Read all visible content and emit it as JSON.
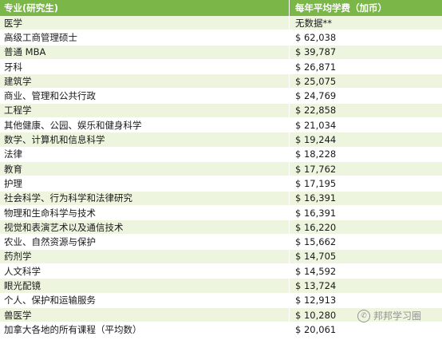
{
  "header": {
    "col1": "专业(研究生)",
    "col2": "每年平均学费（加币）"
  },
  "rows": [
    {
      "name": "医学",
      "fee": "无数据**"
    },
    {
      "name": "高级工商管理硕士",
      "fee": "$ 62,038"
    },
    {
      "name": "普通 MBA",
      "fee": "$ 39,787"
    },
    {
      "name": "牙科",
      "fee": "$ 26,871"
    },
    {
      "name": "建筑学",
      "fee": "$ 25,075"
    },
    {
      "name": "商业、管理和公共行政",
      "fee": "$ 24,769"
    },
    {
      "name": "工程学",
      "fee": "$ 22,858"
    },
    {
      "name": "其他健康、公园、娱乐和健身科学",
      "fee": "$ 21,034"
    },
    {
      "name": "数学、计算机和信息科学",
      "fee": "$ 19,244"
    },
    {
      "name": "法律",
      "fee": "$ 18,228"
    },
    {
      "name": "教育",
      "fee": "$ 17,762"
    },
    {
      "name": "护理",
      "fee": "$ 17,195"
    },
    {
      "name": "社会科学、行为科学和法律研究",
      "fee": "$ 16,391"
    },
    {
      "name": "物理和生命科学与技术",
      "fee": "$ 16,391"
    },
    {
      "name": "视觉和表演艺术以及通信技术",
      "fee": "$ 16,220"
    },
    {
      "name": "农业、自然资源与保护",
      "fee": "$ 15,662"
    },
    {
      "name": "药剂学",
      "fee": "$ 14,705"
    },
    {
      "name": "人文科学",
      "fee": "$ 14,592"
    },
    {
      "name": "眼光配镜",
      "fee": "$ 13,724"
    },
    {
      "name": "个人、保护和运输服务",
      "fee": "$ 12,913"
    },
    {
      "name": "兽医学",
      "fee": "$ 10,280"
    },
    {
      "name": "加拿大各地的所有课程（平均数）",
      "fee": "$ 20,061"
    }
  ],
  "watermark": {
    "icon": "wechat-icon",
    "text": "邦邦学习圈"
  },
  "colors": {
    "header": "#7ab648",
    "stripe": "#eef5df"
  }
}
